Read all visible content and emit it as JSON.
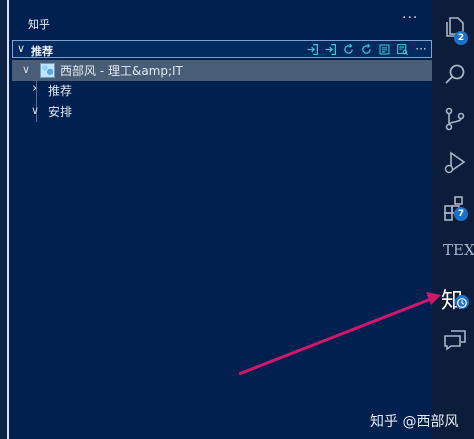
{
  "sidebar": {
    "title": "知乎",
    "more": "···",
    "section": {
      "chevron": "∨",
      "label": "推荐",
      "more": "···"
    },
    "tree": [
      {
        "chevron": "∨",
        "label": "西部风 - 理工&amp;IT",
        "selected": true
      },
      {
        "chevron": "›",
        "label": "推荐"
      },
      {
        "chevron": "∨",
        "label": "安排"
      }
    ]
  },
  "activity_bar": {
    "explorer_badge": "2",
    "extensions_badge": "7",
    "tex_label": "TEX",
    "zhihu_label": "知"
  },
  "watermark": "知乎 @西部风",
  "colors": {
    "accent": "#1c72c9",
    "action_icon": "#3cc7d2",
    "arrow": "#d0176a",
    "selection": "#4a5d77"
  }
}
